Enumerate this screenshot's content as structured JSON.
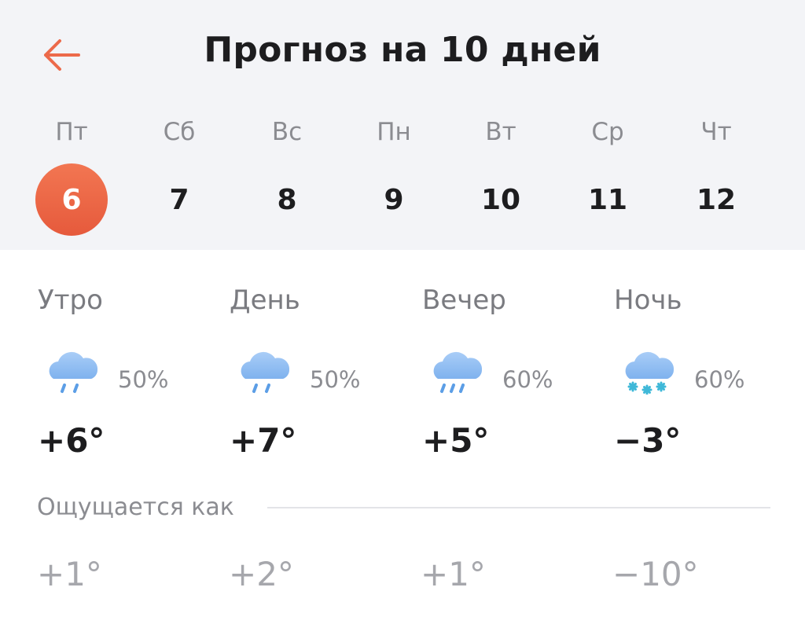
{
  "header": {
    "title": "Прогноз на 10 дней",
    "back_icon": "arrow-left-icon",
    "accent": "#e65a3c",
    "background": "#f3f4f7"
  },
  "days": [
    {
      "dow": "Пт",
      "num": "6",
      "selected": true
    },
    {
      "dow": "Сб",
      "num": "7"
    },
    {
      "dow": "Вс",
      "num": "8"
    },
    {
      "dow": "Пн",
      "num": "9"
    },
    {
      "dow": "Вт",
      "num": "10"
    },
    {
      "dow": "Ср",
      "num": "11"
    },
    {
      "dow": "Чт",
      "num": "12"
    }
  ],
  "periods": [
    {
      "name": "Утро",
      "icon": "cloud-rain-icon",
      "prob": "50%",
      "temp": "+6°",
      "feels": "+1°"
    },
    {
      "name": "День",
      "icon": "cloud-rain-icon",
      "prob": "50%",
      "temp": "+7°",
      "feels": "+2°"
    },
    {
      "name": "Вечер",
      "icon": "cloud-heavy-rain-icon",
      "prob": "60%",
      "temp": "+5°",
      "feels": "+1°"
    },
    {
      "name": "Ночь",
      "icon": "cloud-snow-icon",
      "prob": "60%",
      "temp": "−3°",
      "feels": "−10°"
    }
  ],
  "feels_label": "Ощущается как"
}
